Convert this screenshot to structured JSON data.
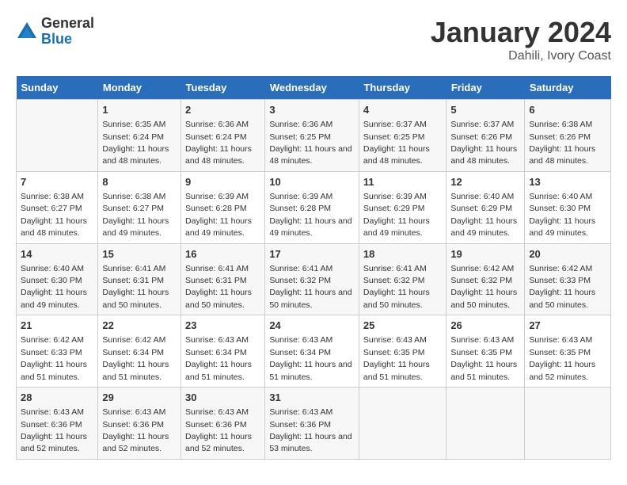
{
  "logo": {
    "general": "General",
    "blue": "Blue"
  },
  "title": "January 2024",
  "location": "Dahili, Ivory Coast",
  "days_of_week": [
    "Sunday",
    "Monday",
    "Tuesday",
    "Wednesday",
    "Thursday",
    "Friday",
    "Saturday"
  ],
  "weeks": [
    [
      {
        "day": "",
        "sunrise": "",
        "sunset": "",
        "daylight": ""
      },
      {
        "day": "1",
        "sunrise": "Sunrise: 6:35 AM",
        "sunset": "Sunset: 6:24 PM",
        "daylight": "Daylight: 11 hours and 48 minutes."
      },
      {
        "day": "2",
        "sunrise": "Sunrise: 6:36 AM",
        "sunset": "Sunset: 6:24 PM",
        "daylight": "Daylight: 11 hours and 48 minutes."
      },
      {
        "day": "3",
        "sunrise": "Sunrise: 6:36 AM",
        "sunset": "Sunset: 6:25 PM",
        "daylight": "Daylight: 11 hours and 48 minutes."
      },
      {
        "day": "4",
        "sunrise": "Sunrise: 6:37 AM",
        "sunset": "Sunset: 6:25 PM",
        "daylight": "Daylight: 11 hours and 48 minutes."
      },
      {
        "day": "5",
        "sunrise": "Sunrise: 6:37 AM",
        "sunset": "Sunset: 6:26 PM",
        "daylight": "Daylight: 11 hours and 48 minutes."
      },
      {
        "day": "6",
        "sunrise": "Sunrise: 6:38 AM",
        "sunset": "Sunset: 6:26 PM",
        "daylight": "Daylight: 11 hours and 48 minutes."
      }
    ],
    [
      {
        "day": "7",
        "sunrise": "Sunrise: 6:38 AM",
        "sunset": "Sunset: 6:27 PM",
        "daylight": "Daylight: 11 hours and 48 minutes."
      },
      {
        "day": "8",
        "sunrise": "Sunrise: 6:38 AM",
        "sunset": "Sunset: 6:27 PM",
        "daylight": "Daylight: 11 hours and 49 minutes."
      },
      {
        "day": "9",
        "sunrise": "Sunrise: 6:39 AM",
        "sunset": "Sunset: 6:28 PM",
        "daylight": "Daylight: 11 hours and 49 minutes."
      },
      {
        "day": "10",
        "sunrise": "Sunrise: 6:39 AM",
        "sunset": "Sunset: 6:28 PM",
        "daylight": "Daylight: 11 hours and 49 minutes."
      },
      {
        "day": "11",
        "sunrise": "Sunrise: 6:39 AM",
        "sunset": "Sunset: 6:29 PM",
        "daylight": "Daylight: 11 hours and 49 minutes."
      },
      {
        "day": "12",
        "sunrise": "Sunrise: 6:40 AM",
        "sunset": "Sunset: 6:29 PM",
        "daylight": "Daylight: 11 hours and 49 minutes."
      },
      {
        "day": "13",
        "sunrise": "Sunrise: 6:40 AM",
        "sunset": "Sunset: 6:30 PM",
        "daylight": "Daylight: 11 hours and 49 minutes."
      }
    ],
    [
      {
        "day": "14",
        "sunrise": "Sunrise: 6:40 AM",
        "sunset": "Sunset: 6:30 PM",
        "daylight": "Daylight: 11 hours and 49 minutes."
      },
      {
        "day": "15",
        "sunrise": "Sunrise: 6:41 AM",
        "sunset": "Sunset: 6:31 PM",
        "daylight": "Daylight: 11 hours and 50 minutes."
      },
      {
        "day": "16",
        "sunrise": "Sunrise: 6:41 AM",
        "sunset": "Sunset: 6:31 PM",
        "daylight": "Daylight: 11 hours and 50 minutes."
      },
      {
        "day": "17",
        "sunrise": "Sunrise: 6:41 AM",
        "sunset": "Sunset: 6:32 PM",
        "daylight": "Daylight: 11 hours and 50 minutes."
      },
      {
        "day": "18",
        "sunrise": "Sunrise: 6:41 AM",
        "sunset": "Sunset: 6:32 PM",
        "daylight": "Daylight: 11 hours and 50 minutes."
      },
      {
        "day": "19",
        "sunrise": "Sunrise: 6:42 AM",
        "sunset": "Sunset: 6:32 PM",
        "daylight": "Daylight: 11 hours and 50 minutes."
      },
      {
        "day": "20",
        "sunrise": "Sunrise: 6:42 AM",
        "sunset": "Sunset: 6:33 PM",
        "daylight": "Daylight: 11 hours and 50 minutes."
      }
    ],
    [
      {
        "day": "21",
        "sunrise": "Sunrise: 6:42 AM",
        "sunset": "Sunset: 6:33 PM",
        "daylight": "Daylight: 11 hours and 51 minutes."
      },
      {
        "day": "22",
        "sunrise": "Sunrise: 6:42 AM",
        "sunset": "Sunset: 6:34 PM",
        "daylight": "Daylight: 11 hours and 51 minutes."
      },
      {
        "day": "23",
        "sunrise": "Sunrise: 6:43 AM",
        "sunset": "Sunset: 6:34 PM",
        "daylight": "Daylight: 11 hours and 51 minutes."
      },
      {
        "day": "24",
        "sunrise": "Sunrise: 6:43 AM",
        "sunset": "Sunset: 6:34 PM",
        "daylight": "Daylight: 11 hours and 51 minutes."
      },
      {
        "day": "25",
        "sunrise": "Sunrise: 6:43 AM",
        "sunset": "Sunset: 6:35 PM",
        "daylight": "Daylight: 11 hours and 51 minutes."
      },
      {
        "day": "26",
        "sunrise": "Sunrise: 6:43 AM",
        "sunset": "Sunset: 6:35 PM",
        "daylight": "Daylight: 11 hours and 51 minutes."
      },
      {
        "day": "27",
        "sunrise": "Sunrise: 6:43 AM",
        "sunset": "Sunset: 6:35 PM",
        "daylight": "Daylight: 11 hours and 52 minutes."
      }
    ],
    [
      {
        "day": "28",
        "sunrise": "Sunrise: 6:43 AM",
        "sunset": "Sunset: 6:36 PM",
        "daylight": "Daylight: 11 hours and 52 minutes."
      },
      {
        "day": "29",
        "sunrise": "Sunrise: 6:43 AM",
        "sunset": "Sunset: 6:36 PM",
        "daylight": "Daylight: 11 hours and 52 minutes."
      },
      {
        "day": "30",
        "sunrise": "Sunrise: 6:43 AM",
        "sunset": "Sunset: 6:36 PM",
        "daylight": "Daylight: 11 hours and 52 minutes."
      },
      {
        "day": "31",
        "sunrise": "Sunrise: 6:43 AM",
        "sunset": "Sunset: 6:36 PM",
        "daylight": "Daylight: 11 hours and 53 minutes."
      },
      {
        "day": "",
        "sunrise": "",
        "sunset": "",
        "daylight": ""
      },
      {
        "day": "",
        "sunrise": "",
        "sunset": "",
        "daylight": ""
      },
      {
        "day": "",
        "sunrise": "",
        "sunset": "",
        "daylight": ""
      }
    ]
  ]
}
